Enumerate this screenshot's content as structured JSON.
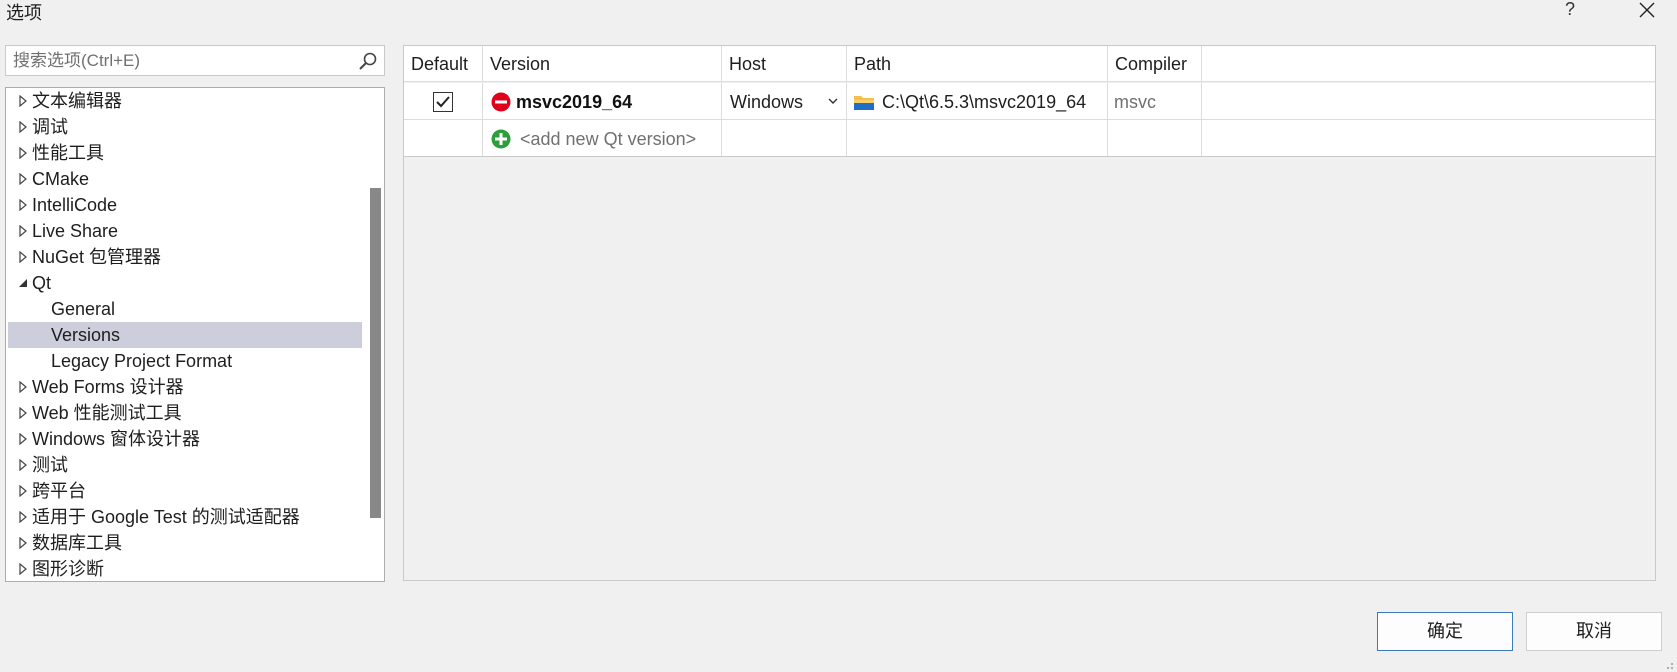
{
  "window": {
    "title": "选项",
    "help_label": "?"
  },
  "search": {
    "placeholder": "搜索选项(Ctrl+E)"
  },
  "tree": {
    "items": [
      {
        "label": "文本编辑器",
        "state": "collapsed"
      },
      {
        "label": "调试",
        "state": "collapsed"
      },
      {
        "label": "性能工具",
        "state": "collapsed"
      },
      {
        "label": "CMake",
        "state": "collapsed"
      },
      {
        "label": "IntelliCode",
        "state": "collapsed"
      },
      {
        "label": "Live Share",
        "state": "collapsed"
      },
      {
        "label": "NuGet 包管理器",
        "state": "collapsed"
      },
      {
        "label": "Qt",
        "state": "expanded"
      },
      {
        "label": "General",
        "state": "child"
      },
      {
        "label": "Versions",
        "state": "child-selected"
      },
      {
        "label": "Legacy Project Format",
        "state": "child"
      },
      {
        "label": "Web Forms 设计器",
        "state": "collapsed"
      },
      {
        "label": "Web 性能测试工具",
        "state": "collapsed"
      },
      {
        "label": "Windows 窗体设计器",
        "state": "collapsed"
      },
      {
        "label": "测试",
        "state": "collapsed"
      },
      {
        "label": "跨平台",
        "state": "collapsed"
      },
      {
        "label": "适用于 Google Test 的测试适配器",
        "state": "collapsed"
      },
      {
        "label": "数据库工具",
        "state": "collapsed"
      },
      {
        "label": "图形诊断",
        "state": "collapsed"
      }
    ]
  },
  "table": {
    "headers": {
      "default": "Default",
      "version": "Version",
      "host": "Host",
      "path": "Path",
      "compiler": "Compiler"
    },
    "rows": [
      {
        "default_checked": true,
        "version": "msvc2019_64",
        "host": "Windows",
        "path": "C:\\Qt\\6.5.3\\msvc2019_64",
        "compiler": "msvc"
      }
    ],
    "add_row_label": "<add new Qt version>"
  },
  "buttons": {
    "ok": "确定",
    "cancel": "取消"
  },
  "colors": {
    "selection": "#cccedb",
    "remove_icon": "#e0001b",
    "add_icon": "#2e9e3a",
    "folder_icon": "#f4c04a",
    "ok_border": "#3d7ab5"
  }
}
